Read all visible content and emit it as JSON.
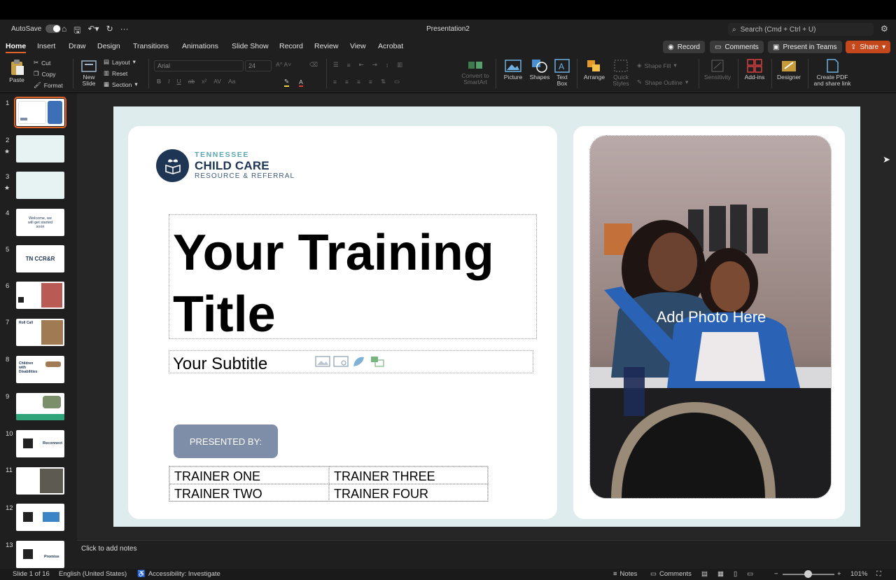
{
  "titlebar": {
    "autosave_label": "AutoSave",
    "doc_title": "Presentation2",
    "search_placeholder": "Search (Cmd + Ctrl + U)"
  },
  "tabs": [
    {
      "label": "Home"
    },
    {
      "label": "Insert"
    },
    {
      "label": "Draw"
    },
    {
      "label": "Design"
    },
    {
      "label": "Transitions"
    },
    {
      "label": "Animations"
    },
    {
      "label": "Slide Show"
    },
    {
      "label": "Record"
    },
    {
      "label": "Review"
    },
    {
      "label": "View"
    },
    {
      "label": "Acrobat"
    }
  ],
  "tab_actions": {
    "record": "Record",
    "comments": "Comments",
    "present_teams": "Present in Teams",
    "share": "Share"
  },
  "ribbon": {
    "paste": "Paste",
    "cut": "Cut",
    "copy": "Copy",
    "format": "Format",
    "new_slide_1": "New",
    "new_slide_2": "Slide",
    "layout": "Layout",
    "reset": "Reset",
    "section": "Section",
    "font_name": "Arial",
    "font_size": "24",
    "convert_1": "Convert to",
    "convert_2": "SmartArt",
    "picture": "Picture",
    "shapes": "Shapes",
    "textbox_1": "Text",
    "textbox_2": "Box",
    "arrange": "Arrange",
    "quick_1": "Quick",
    "quick_2": "Styles",
    "shape_fill": "Shape Fill",
    "shape_outline": "Shape Outline",
    "sensitivity": "Sensitivity",
    "addins": "Add-ins",
    "designer": "Designer",
    "pdf_1": "Create PDF",
    "pdf_2": "and share link"
  },
  "thumbnails": [
    {
      "num": "1",
      "starred": false
    },
    {
      "num": "2",
      "starred": true
    },
    {
      "num": "3",
      "starred": true
    },
    {
      "num": "4",
      "starred": false,
      "text": "Welcome, we will get started soon"
    },
    {
      "num": "5",
      "starred": false,
      "text": "TN CCR&R"
    },
    {
      "num": "6",
      "starred": false
    },
    {
      "num": "7",
      "starred": false,
      "text": "Roll Call"
    },
    {
      "num": "8",
      "starred": false,
      "text": "Children with Disabilities"
    },
    {
      "num": "9",
      "starred": false
    },
    {
      "num": "10",
      "starred": false,
      "text": "Reconnect"
    },
    {
      "num": "11",
      "starred": false
    },
    {
      "num": "12",
      "starred": false
    },
    {
      "num": "13",
      "starred": false,
      "text": "Promise"
    }
  ],
  "slide": {
    "logo_line1": "TENNESSEE",
    "logo_line2": "CHILD CARE",
    "logo_line3": "RESOURCE & REFERRAL",
    "title": "Your Training Title",
    "subtitle": "Your Subtitle",
    "presented_by": "PRESENTED BY:",
    "trainers": [
      "TRAINER ONE",
      "TRAINER THREE",
      "TRAINER TWO",
      "TRAINER FOUR"
    ],
    "photo_caption": "Add Photo Here"
  },
  "notes_placeholder": "Click to add notes",
  "status": {
    "slide_count": "Slide 1 of 16",
    "language": "English (United States)",
    "accessibility": "Accessibility: Investigate",
    "notes": "Notes",
    "comments": "Comments",
    "zoom": "101%"
  },
  "colors": {
    "accent": "#e2632a",
    "slide_bg": "#dfeced",
    "presented_btn": "#7f8ea8",
    "logo_navy": "#1f3554",
    "logo_teal": "#5aa6b1"
  }
}
